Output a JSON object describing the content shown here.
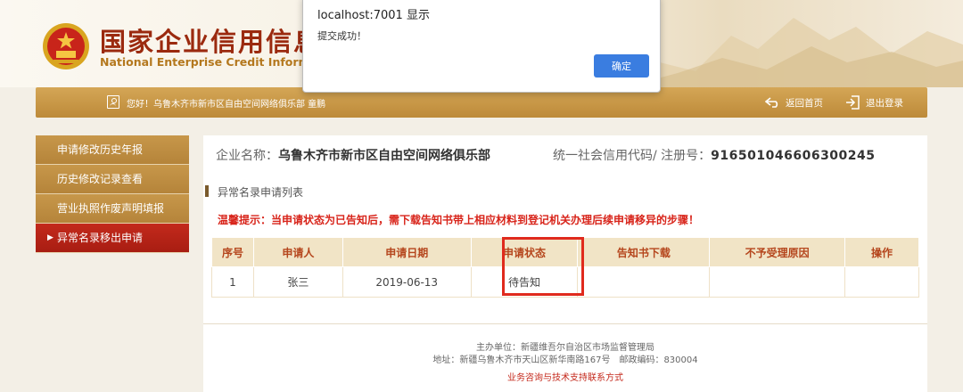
{
  "site": {
    "title_cn": "国家企业信用信息",
    "title_en": "National Enterprise Credit Informatio"
  },
  "navbar": {
    "greeting": "您好！乌鲁木齐市新市区自由空间网络俱乐部 童鹏",
    "home": "返回首页",
    "logout": "退出登录"
  },
  "sidebar": {
    "items": [
      {
        "label": "申请修改历史年报"
      },
      {
        "label": "历史修改记录查看"
      },
      {
        "label": "营业执照作废声明填报"
      },
      {
        "label": "异常名录移出申请",
        "active": true
      }
    ]
  },
  "main": {
    "company_label": "企业名称：",
    "company_name": "乌鲁木齐市新市区自由空间网络俱乐部",
    "code_label": "统一社会信用代码/ 注册号：",
    "code_value": "916501046606300245",
    "section_title": "异常名录申请列表",
    "warning": "温馨提示：当申请状态为已告知后，需下载告知书带上相应材料到登记机关办理后续申请移异的步骤！",
    "table": {
      "headers": [
        "序号",
        "申请人",
        "申请日期",
        "申请状态",
        "告知书下载",
        "不予受理原因",
        "操作"
      ],
      "rows": [
        [
          "1",
          "张三",
          "2019-06-13",
          "待告知",
          "",
          "",
          ""
        ]
      ]
    }
  },
  "footer": {
    "sponsor": "主办单位：新疆维吾尔自治区市场监督管理局",
    "address": "地址：新疆乌鲁木齐市天山区新华南路167号　邮政编码：830004",
    "contact": "业务咨询与技术支持联系方式"
  },
  "dialog": {
    "title": "localhost:7001 显示",
    "message": "提交成功！",
    "ok": "确定"
  },
  "colors": {
    "accent_gold": "#c7974a",
    "active_red": "#b5221a",
    "highlight_red": "#e02a1d",
    "dialog_button": "#3a7de0"
  }
}
